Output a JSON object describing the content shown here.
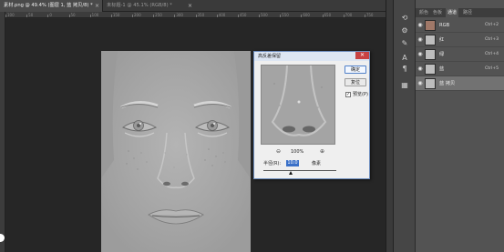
{
  "tabs": {
    "active_label": "素材.png @ 49.4% (图层 1, 蓝 拷贝/8) *",
    "inactive_label": "未标题-1 @ 45.1% (RGB/8) *",
    "close_glyph": "×"
  },
  "ruler": {
    "top_ticks": [
      "100",
      "50",
      "0",
      "50",
      "100",
      "150",
      "200",
      "250",
      "300",
      "350",
      "400",
      "450",
      "500",
      "550",
      "600",
      "650",
      "700",
      "750"
    ]
  },
  "panel": {
    "tabs": [
      "颜色",
      "色板",
      "通道",
      "路径"
    ],
    "selected_tab": "通道",
    "channels": [
      {
        "name": "RGB",
        "shortcut": "Ctrl+2",
        "thumb": "color"
      },
      {
        "name": "红",
        "shortcut": "Ctrl+3",
        "thumb": "gray"
      },
      {
        "name": "绿",
        "shortcut": "Ctrl+4",
        "thumb": "gray"
      },
      {
        "name": "蓝",
        "shortcut": "Ctrl+5",
        "thumb": "gray"
      },
      {
        "name": "蓝 拷贝",
        "shortcut": "",
        "thumb": "gray"
      }
    ],
    "selected_channel": "蓝 拷贝"
  },
  "icon_column": [
    {
      "icon": "history-icon",
      "glyph": "⟲"
    },
    {
      "icon": "properties-icon",
      "glyph": "⚙"
    },
    {
      "icon": "brush-settings-icon",
      "glyph": "✎"
    },
    {
      "icon": "character-icon",
      "glyph": "A"
    },
    {
      "icon": "paragraph-icon",
      "glyph": "¶"
    },
    {
      "icon": "layers-icon",
      "glyph": "▦"
    }
  ],
  "dialog": {
    "title": "高反差保留",
    "close_glyph": "✕",
    "ok_label": "确定",
    "reset_label": "复位",
    "preview_label": "预览(P)",
    "preview_checked": true,
    "zoom_level": "100%",
    "radius_label": "半径(R):",
    "radius_value": "10.0",
    "radius_unit": "像素",
    "slider_fraction": 0.38
  },
  "colors": {
    "workspace_bg": "#282828",
    "panel_bg": "#535353",
    "dialog_bg": "#efefef",
    "selection_blue": "#3a70c8"
  }
}
